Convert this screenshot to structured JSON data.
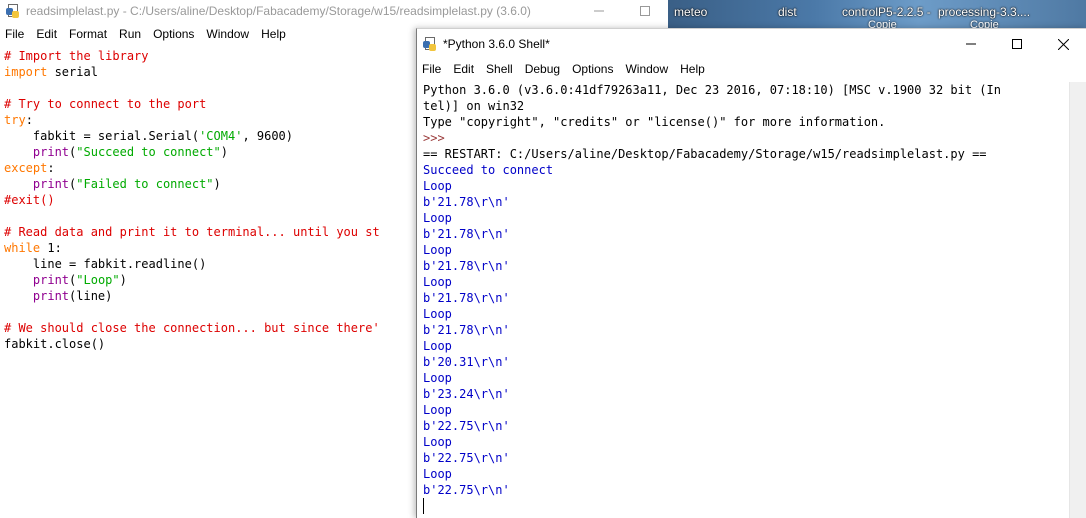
{
  "desktop": {
    "items": [
      {
        "label": "meteo"
      },
      {
        "label": "dist"
      },
      {
        "label": "controlP5-2.2.5 -",
        "sub": "Copie"
      },
      {
        "label": "processing-3.3....",
        "sub": "Copie"
      }
    ]
  },
  "editor": {
    "title": "readsimplelast.py - C:/Users/aline/Desktop/Fabacademy/Storage/w15/readsimplelast.py (3.6.0)",
    "menu": [
      "File",
      "Edit",
      "Format",
      "Run",
      "Options",
      "Window",
      "Help"
    ],
    "code": [
      [
        {
          "t": "# Import the library",
          "c": "cm"
        }
      ],
      [
        {
          "t": "import",
          "c": "kw"
        },
        {
          "t": " serial",
          "c": "tx"
        }
      ],
      [
        {
          "t": "",
          "c": "tx"
        }
      ],
      [
        {
          "t": "# Try to connect to the port",
          "c": "cm"
        }
      ],
      [
        {
          "t": "try",
          "c": "kw"
        },
        {
          "t": ":",
          "c": "tx"
        }
      ],
      [
        {
          "t": "    fabkit = serial.Serial(",
          "c": "tx"
        },
        {
          "t": "'COM4'",
          "c": "st"
        },
        {
          "t": ", 9600)",
          "c": "tx"
        }
      ],
      [
        {
          "t": "    ",
          "c": "tx"
        },
        {
          "t": "print",
          "c": "bi"
        },
        {
          "t": "(",
          "c": "tx"
        },
        {
          "t": "\"Succeed to connect\"",
          "c": "st"
        },
        {
          "t": ")",
          "c": "tx"
        }
      ],
      [
        {
          "t": "except",
          "c": "kw"
        },
        {
          "t": ":",
          "c": "tx"
        }
      ],
      [
        {
          "t": "    ",
          "c": "tx"
        },
        {
          "t": "print",
          "c": "bi"
        },
        {
          "t": "(",
          "c": "tx"
        },
        {
          "t": "\"Failed to connect\"",
          "c": "st"
        },
        {
          "t": ")",
          "c": "tx"
        }
      ],
      [
        {
          "t": "#exit()",
          "c": "cm"
        }
      ],
      [
        {
          "t": "",
          "c": "tx"
        }
      ],
      [
        {
          "t": "# Read data and print it to terminal... until you st",
          "c": "cm"
        }
      ],
      [
        {
          "t": "while",
          "c": "kw"
        },
        {
          "t": " 1:",
          "c": "tx"
        }
      ],
      [
        {
          "t": "    line = fabkit.readline()",
          "c": "tx"
        }
      ],
      [
        {
          "t": "    ",
          "c": "tx"
        },
        {
          "t": "print",
          "c": "bi"
        },
        {
          "t": "(",
          "c": "tx"
        },
        {
          "t": "\"Loop\"",
          "c": "st"
        },
        {
          "t": ")",
          "c": "tx"
        }
      ],
      [
        {
          "t": "    ",
          "c": "tx"
        },
        {
          "t": "print",
          "c": "bi"
        },
        {
          "t": "(line)",
          "c": "tx"
        }
      ],
      [
        {
          "t": "",
          "c": "tx"
        }
      ],
      [
        {
          "t": "# We should close the connection... but since there'",
          "c": "cm"
        }
      ],
      [
        {
          "t": "fabkit.close()",
          "c": "tx"
        }
      ]
    ]
  },
  "shell": {
    "title": "*Python 3.6.0 Shell*",
    "menu": [
      "File",
      "Edit",
      "Shell",
      "Debug",
      "Options",
      "Window",
      "Help"
    ],
    "lines": [
      {
        "t": "Python 3.6.0 (v3.6.0:41df79263a11, Dec 23 2016, 07:18:10) [MSC v.1900 32 bit (In",
        "k": "plain"
      },
      {
        "t": "tel)] on win32",
        "k": "plain"
      },
      {
        "t": "Type \"copyright\", \"credits\" or \"license()\" for more information.",
        "k": "plain"
      },
      {
        "t": ">>>",
        "k": "prompt"
      },
      {
        "t": "== RESTART: C:/Users/aline/Desktop/Fabacademy/Storage/w15/readsimplelast.py ==",
        "k": "restart"
      },
      {
        "t": "Succeed to connect",
        "k": "out"
      },
      {
        "t": "Loop",
        "k": "out"
      },
      {
        "t": "b'21.78\\r\\n'",
        "k": "out"
      },
      {
        "t": "Loop",
        "k": "out"
      },
      {
        "t": "b'21.78\\r\\n'",
        "k": "out"
      },
      {
        "t": "Loop",
        "k": "out"
      },
      {
        "t": "b'21.78\\r\\n'",
        "k": "out"
      },
      {
        "t": "Loop",
        "k": "out"
      },
      {
        "t": "b'21.78\\r\\n'",
        "k": "out"
      },
      {
        "t": "Loop",
        "k": "out"
      },
      {
        "t": "b'21.78\\r\\n'",
        "k": "out"
      },
      {
        "t": "Loop",
        "k": "out"
      },
      {
        "t": "b'20.31\\r\\n'",
        "k": "out"
      },
      {
        "t": "Loop",
        "k": "out"
      },
      {
        "t": "b'23.24\\r\\n'",
        "k": "out"
      },
      {
        "t": "Loop",
        "k": "out"
      },
      {
        "t": "b'22.75\\r\\n'",
        "k": "out"
      },
      {
        "t": "Loop",
        "k": "out"
      },
      {
        "t": "b'22.75\\r\\n'",
        "k": "out"
      },
      {
        "t": "Loop",
        "k": "out"
      },
      {
        "t": "b'22.75\\r\\n'",
        "k": "out"
      }
    ]
  },
  "icons": {
    "minimize": "minimize-icon",
    "maximize": "maximize-icon",
    "close": "close-icon",
    "app": "python-idle-icon"
  }
}
